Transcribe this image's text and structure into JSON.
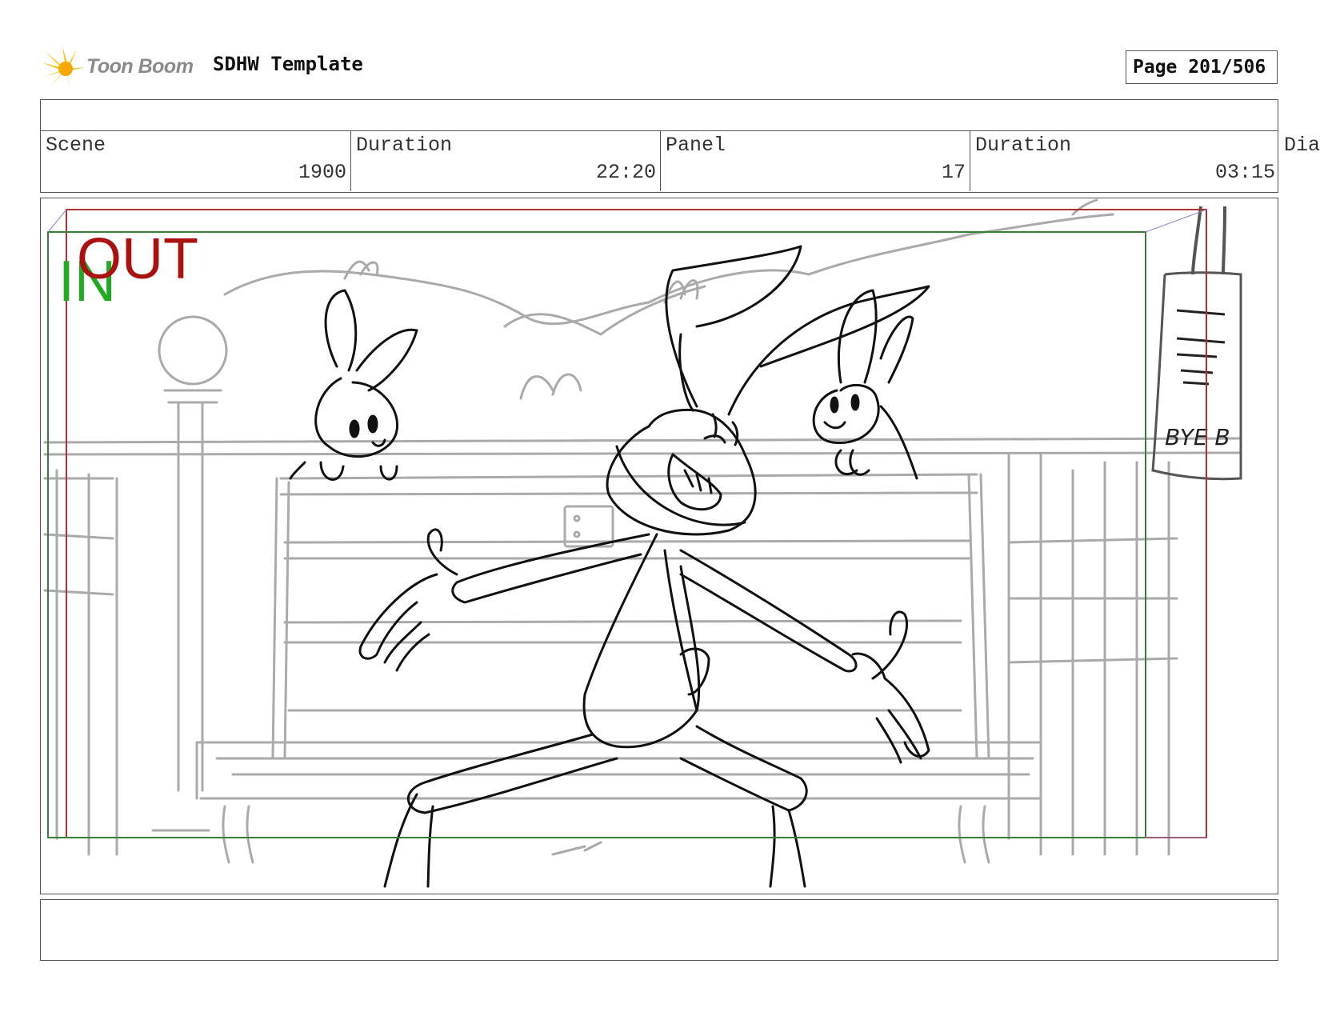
{
  "header": {
    "logo_text": "Toon Boom",
    "title": "SDHW Template",
    "page": "Page 201/506"
  },
  "info": {
    "scene_label": "Scene",
    "scene_value": "1900",
    "scene_duration_label": "Duration",
    "scene_duration_value": "22:20",
    "panel_label": "Panel",
    "panel_value": "17",
    "panel_duration_label": "Duration",
    "panel_duration_value": "03:15",
    "overflow_label": "Dia"
  },
  "panel": {
    "in_marker": "IN",
    "out_marker": "OUT",
    "sign_text": "BYE B",
    "in_color": "#22aa22",
    "out_color": "#aa1111",
    "safe_frame_color": "#3a7d3a",
    "camera_frame_color": "#b03030"
  }
}
